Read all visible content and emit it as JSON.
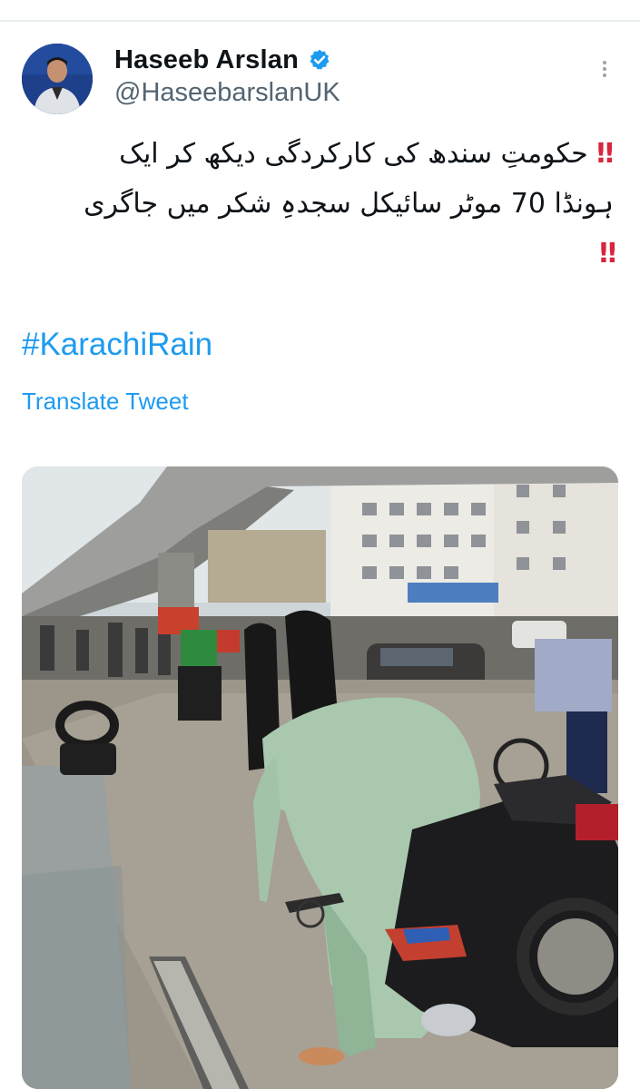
{
  "tweet": {
    "display_name": "Haseeb Arslan",
    "handle": "@HaseebarslanUK",
    "text_line1": "حکومتِ سندھ کی کارکردگی دیکھ کر ایک",
    "text_line2": "ہونڈا 70 موٹر سائیکل سجدہِ شکر میں جاگری",
    "emphasis": "‼",
    "hashtag": "#KarachiRain",
    "translate_label": "Translate Tweet"
  },
  "icons": {
    "verified": "verified-badge-icon",
    "more": "more-options-icon"
  },
  "colors": {
    "link": "#1d9bf0",
    "verified": "#1d9bf0",
    "emphasis": "#d7263d",
    "name": "#0f1419",
    "handle": "#536471"
  }
}
